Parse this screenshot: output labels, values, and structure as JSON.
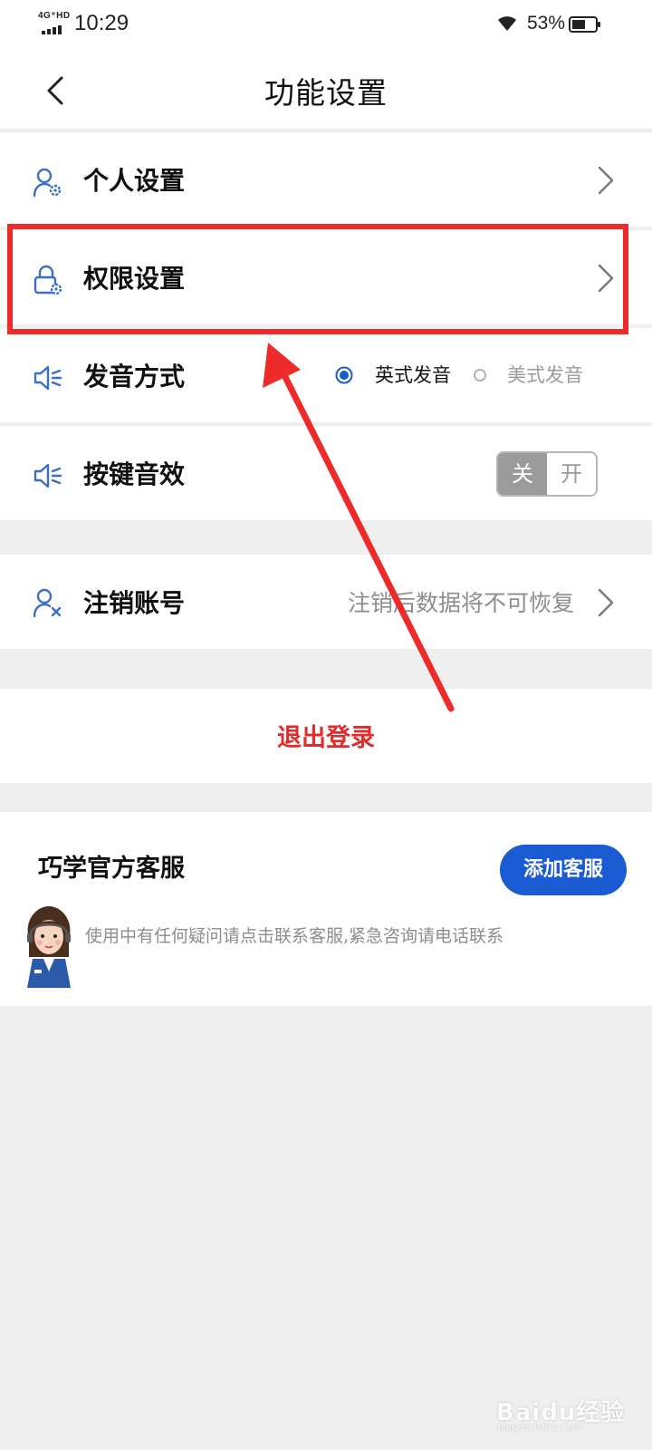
{
  "status_bar": {
    "network": "4G⁺HD",
    "time": "10:29",
    "battery_percent": "53%"
  },
  "nav": {
    "title": "功能设置"
  },
  "settings": {
    "personal": {
      "label": "个人设置"
    },
    "permission": {
      "label": "权限设置"
    },
    "pronunciation": {
      "label": "发音方式",
      "options": [
        "英式发音",
        "美式发音"
      ],
      "selected": "英式发音"
    },
    "key_sound": {
      "label": "按键音效",
      "off_label": "关",
      "on_label": "开",
      "state": "off"
    }
  },
  "account": {
    "cancel_label": "注销账号",
    "cancel_hint": "注销后数据将不可恢复"
  },
  "logout": {
    "label": "退出登录"
  },
  "customer_service": {
    "title": "巧学官方客服",
    "button": "添加客服",
    "description": "使用中有任何疑问请点击联系客服,紧急咨询请电话联系"
  },
  "watermark": {
    "text": "Baidu经验",
    "sub": "jingyan.baidu.com"
  },
  "colors": {
    "accent_blue": "#1a5ad2",
    "logout_red": "#e22b2b",
    "annotation_red": "#ee2b2b",
    "icon_blue": "#3a6fc8"
  }
}
